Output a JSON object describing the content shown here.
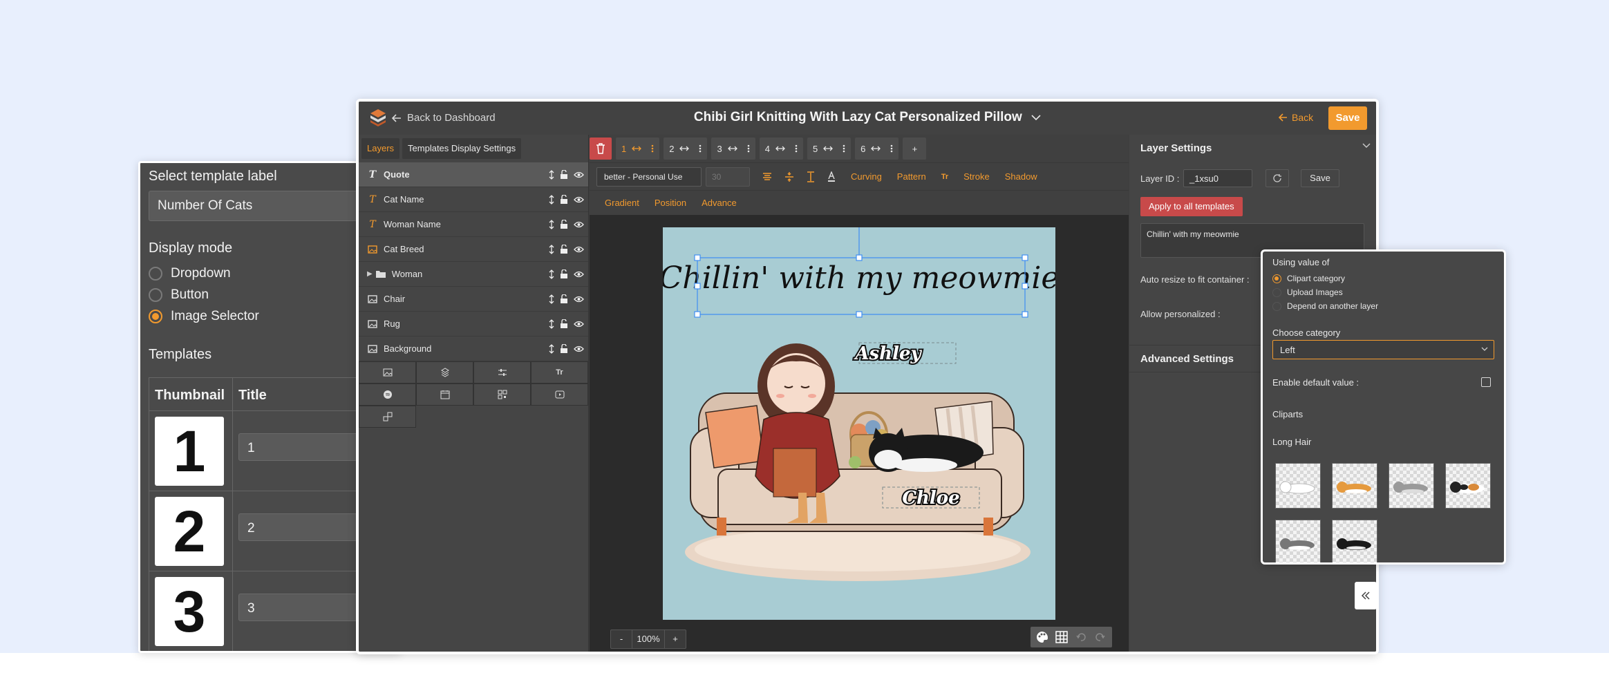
{
  "template_panel": {
    "select_label": "Select template label",
    "label_value": "Number Of Cats",
    "display_mode_label": "Display mode",
    "modes": [
      "Dropdown",
      "Button",
      "Image Selector"
    ],
    "selected_mode": "Image Selector",
    "templates_label": "Templates",
    "columns": [
      "Thumbnail",
      "Title"
    ],
    "rows": [
      {
        "thumb": "1",
        "title": "1"
      },
      {
        "thumb": "2",
        "title": "2"
      },
      {
        "thumb": "3",
        "title": "3"
      }
    ]
  },
  "header": {
    "back_to_dashboard": "Back to Dashboard",
    "title": "Chibi Girl Knitting With Lazy Cat Personalized Pillow",
    "back": "Back",
    "save": "Save"
  },
  "layers_panel": {
    "tabs": [
      "Layers",
      "Templates Display Settings"
    ],
    "layers": [
      {
        "name": "Quote",
        "type": "text",
        "selected": true
      },
      {
        "name": "Cat Name",
        "type": "text"
      },
      {
        "name": "Woman Name",
        "type": "text"
      },
      {
        "name": "Cat Breed",
        "type": "image-orange"
      },
      {
        "name": "Woman",
        "type": "folder"
      },
      {
        "name": "Chair",
        "type": "image"
      },
      {
        "name": "Rug",
        "type": "image"
      },
      {
        "name": "Background",
        "type": "image"
      }
    ]
  },
  "toolbar": {
    "template_chips": [
      "1",
      "2",
      "3",
      "4",
      "5",
      "6"
    ],
    "add": "+",
    "font": "better - Personal Use",
    "font_size": "30",
    "links_row1": [
      "Curving",
      "Pattern",
      "Stroke",
      "Shadow"
    ],
    "links_row2": [
      "Gradient",
      "Position",
      "Advance"
    ]
  },
  "canvas": {
    "quote_text": "Chillin' with my meowmie",
    "woman_name": "Ashley",
    "cat_name": "Chloe",
    "zoom": "100%",
    "zoom_minus": "-",
    "zoom_plus": "+"
  },
  "layer_settings": {
    "title": "Layer Settings",
    "layer_id_label": "Layer ID :",
    "layer_id": "_1xsu0",
    "save": "Save",
    "apply_all": "Apply to all templates",
    "quote_value": "Chillin' with my meowmie",
    "auto_resize_label": "Auto resize to fit container :",
    "allow_personalized_label": "Allow personalized :",
    "advanced": "Advanced Settings"
  },
  "popup": {
    "using_value_label": "Using value of",
    "options": [
      "Clipart category",
      "Upload Images",
      "Depend on another layer"
    ],
    "selected_option": "Clipart category",
    "choose_category_label": "Choose category",
    "category": "Left",
    "enable_default_label": "Enable default value :",
    "cliparts_label": "Cliparts",
    "group_label": "Long Hair",
    "cliparts": [
      "white-cat",
      "orange-tabby-cat",
      "gray-tabby-cat",
      "calico-cat",
      "gray-white-cat",
      "black-cat"
    ]
  },
  "colors": {
    "accent": "#f29a2e",
    "danger": "#c84a4a",
    "canvas_bg": "#a8ccd3",
    "page_bg": "#e8effd"
  }
}
